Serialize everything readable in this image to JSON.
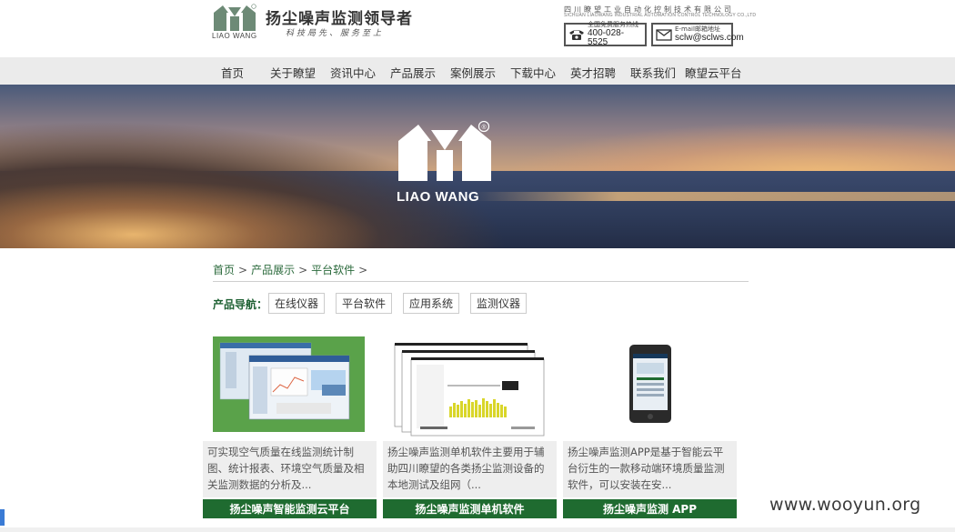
{
  "header": {
    "logo_caption": "LIAO WANG",
    "brand_title": "扬尘噪声监测领导者",
    "brand_slogan": "科技局先、服务至上",
    "company_cn": "四川瞭望工业自动化控制技术有限公司",
    "company_en": "SICHUAN LIAOWANG INDUSTRIAL AUTOMATION CONTROL TECHNOLOGY CO.,LTD",
    "phone": {
      "label": "全国免费服务热线",
      "value": "400-028-5525",
      "icon": "phone-icon"
    },
    "email": {
      "label": "E-mail邮箱地址",
      "value": "sclw@sclws.com",
      "icon": "envelope-icon"
    }
  },
  "nav": {
    "items": [
      "首页",
      "关于瞭望",
      "资讯中心",
      "产品展示",
      "案例展示",
      "下载中心",
      "英才招聘",
      "联系我们",
      "瞭望云平台"
    ]
  },
  "banner": {
    "logo_text": "LIAO WANG",
    "registered_mark": "®"
  },
  "breadcrumb": {
    "items": [
      "首页",
      "产品展示",
      "平台软件"
    ],
    "separator": ">"
  },
  "product_nav": {
    "label": "产品导航：",
    "buttons": [
      "在线仪器",
      "平台软件",
      "应用系统",
      "监测仪器"
    ]
  },
  "products": [
    {
      "description": "可实现空气质量在线监测统计制图、统计报表、环境空气质量及相关监测数据的分析及...",
      "title": "扬尘噪声智能监测云平台"
    },
    {
      "description": "扬尘噪声监测单机软件主要用于辅助四川瞭望的各类扬尘监测设备的本地测试及组网（...",
      "title": "扬尘噪声监测单机软件"
    },
    {
      "description": "扬尘噪声监测APP是基于智能云平台衍生的一款移动端环境质量监测软件，可以安装在安...",
      "title": "扬尘噪声监测 APP"
    }
  ],
  "watermark": "www.wooyun.org",
  "colors": {
    "brand_green": "#1f6b30",
    "nav_bg": "#ebebeb",
    "link_green": "#2b6a3c"
  }
}
